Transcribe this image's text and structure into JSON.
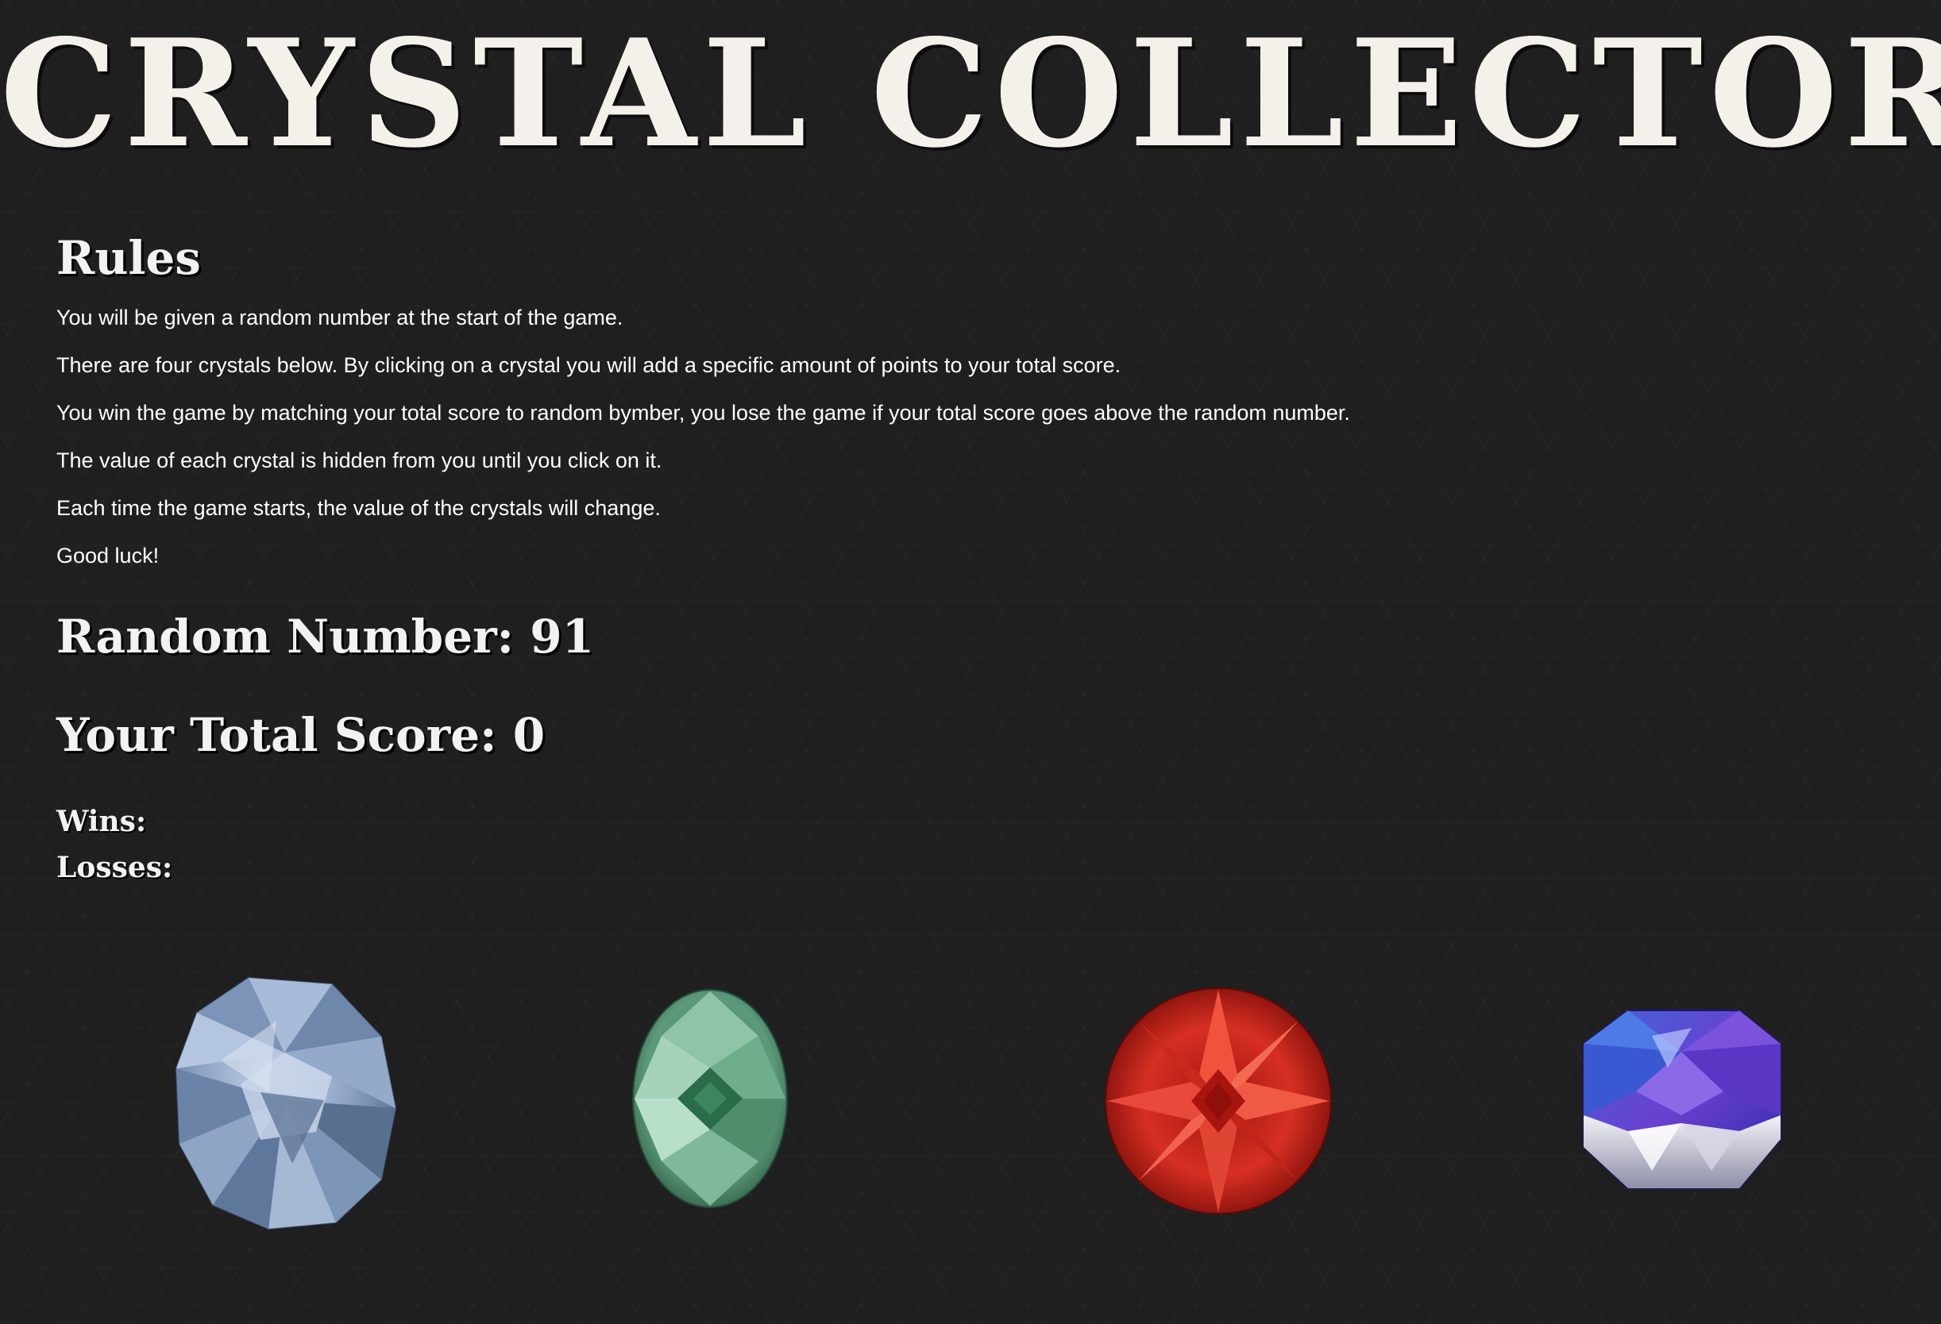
{
  "title": "CRYSTAL COLLECTOR",
  "rules": {
    "heading": "Rules",
    "lines": [
      "You will be given a random number at the start of the game.",
      "There are four crystals below. By clicking on a crystal you will add a specific amount of points to your total score.",
      "You win the game by matching your total score to random bymber, you lose the game if your total score goes above the random number.",
      "The value of each crystal is hidden from you until you click on it.",
      "Each time the game starts, the value of the crystals will change.",
      "Good luck!"
    ]
  },
  "stats": {
    "random_number": "Random Number: 91",
    "total_score": "Your Total Score: 0",
    "wins": "Wins:",
    "losses": "Losses:"
  },
  "crystals": [
    {
      "name": "blue-gray-crystal",
      "color": "#7f97b8"
    },
    {
      "name": "green-crystal",
      "color": "#4e8c6c"
    },
    {
      "name": "red-crystal",
      "color": "#d12a1f"
    },
    {
      "name": "purple-crystal",
      "color": "#5a3bc7"
    }
  ],
  "colors": {
    "background": "#1f1f1f",
    "text": "#ffffff"
  }
}
